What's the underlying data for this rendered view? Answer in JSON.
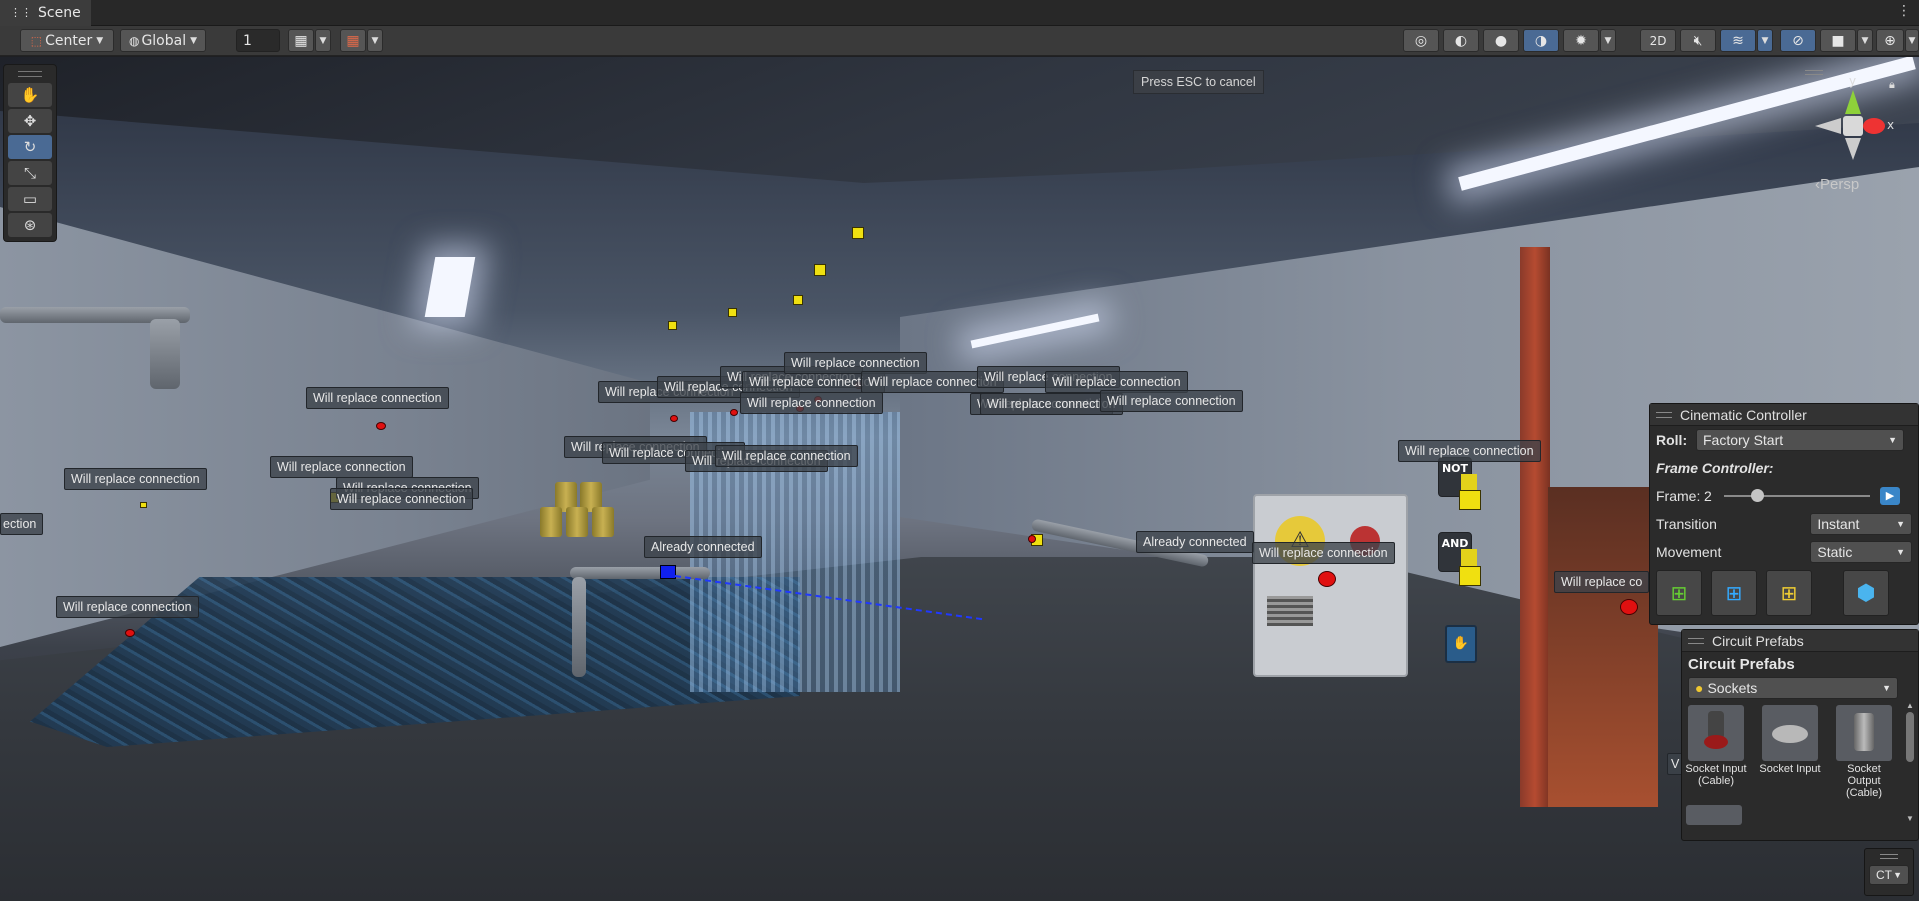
{
  "window": {
    "tab_title": "Scene",
    "menu_icon": "kebab-menu-icon"
  },
  "toolbar": {
    "pivot_mode": "Center",
    "pivot_rotation": "Global",
    "grid_snap_value": "1",
    "view_2d": "2D"
  },
  "viewport": {
    "esc_hint": "Press ESC to cancel",
    "camera_mode": "Persp",
    "gizmo_axes": {
      "y": "y",
      "x": "x"
    }
  },
  "labels": {
    "replace": "Will replace connection",
    "connected": "Already connected",
    "partial_left": "ection",
    "partial_right": "Will replace co",
    "edge_v": "V"
  },
  "scene_signs": {
    "not_gate": "NOT",
    "and_gate": "AND"
  },
  "cinematic": {
    "title": "Cinematic Controller",
    "roll_label": "Roll:",
    "roll_value": "Factory Start",
    "frame_controller": "Frame Controller:",
    "frame_label": "Frame:",
    "frame_value": "2",
    "frame_slider_fraction": 0.2,
    "transition_label": "Transition",
    "transition_value": "Instant",
    "movement_label": "Movement",
    "movement_value": "Static"
  },
  "prefabs": {
    "panel_title": "Circuit Prefabs",
    "heading": "Circuit Prefabs",
    "category": "Sockets",
    "items": [
      {
        "label": "Socket Input (Cable)"
      },
      {
        "label": "Socket Input"
      },
      {
        "label": "Socket Output (Cable)"
      }
    ]
  },
  "bottom_right": {
    "ct_dropdown": "CT"
  },
  "colors": {
    "accent_blue": "#4a6a94",
    "marker_red": "#e01010",
    "marker_yellow": "#f0e010",
    "marker_blue": "#1020f0"
  }
}
